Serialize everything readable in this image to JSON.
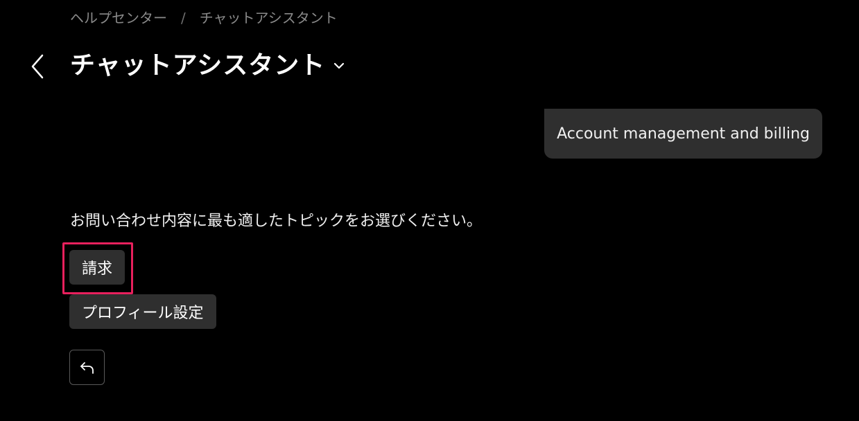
{
  "breadcrumb": {
    "items": [
      "ヘルプセンター",
      "チャットアシスタント"
    ],
    "separator": "/"
  },
  "header": {
    "title": "チャットアシスタント",
    "back_icon": "chevron-left-icon",
    "dropdown_icon": "chevron-down-icon"
  },
  "chat": {
    "user_message": "Account management and billing",
    "assistant_prompt": "お問い合わせ内容に最も適したトピックをお選びください。",
    "options": [
      {
        "label": "請求",
        "highlighted": true
      },
      {
        "label": "プロフィール設定",
        "highlighted": false
      }
    ],
    "undo_icon": "undo-arrow-icon"
  },
  "colors": {
    "background": "#000000",
    "bubble": "#2f2f2f",
    "highlight": "#e8205d",
    "muted_text": "#8a8a8a"
  }
}
